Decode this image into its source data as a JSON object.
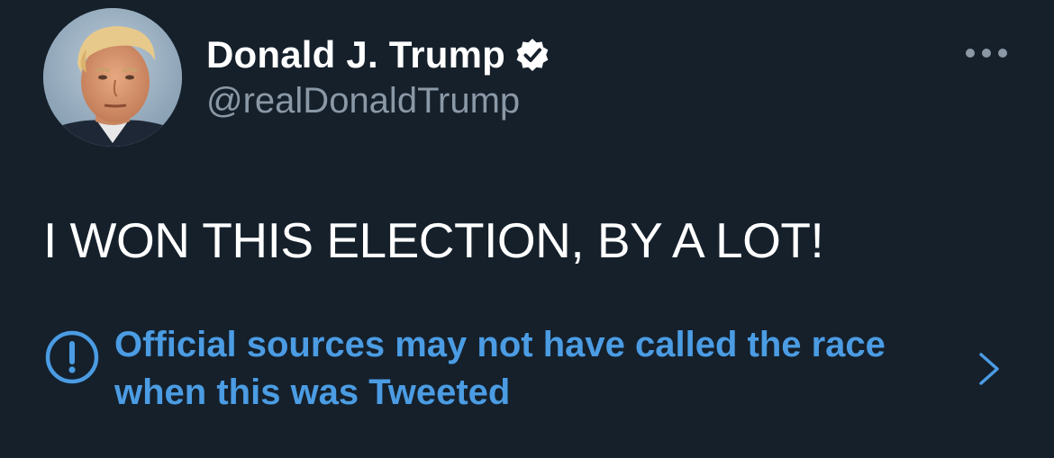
{
  "tweet": {
    "author": {
      "display_name": "Donald J. Trump",
      "handle": "@realDonaldTrump",
      "verified": true,
      "avatar_icon": "profile-photo"
    },
    "text": "I WON THIS ELECTION, BY A LOT!",
    "notice": {
      "text": "Official sources may not have called the race when this was Tweeted",
      "icon": "exclamation-circle-icon",
      "chevron": "chevron-right-icon"
    },
    "more_icon": "more-options-icon"
  },
  "colors": {
    "background": "#15202b",
    "primary_text": "#ffffff",
    "secondary_text": "#8b98a5",
    "accent": "#4b9ce3"
  }
}
